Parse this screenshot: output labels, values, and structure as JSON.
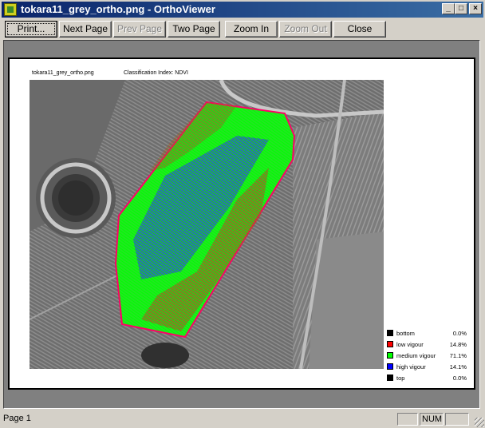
{
  "window": {
    "title": "tokara11_grey_ortho.png - OrthoViewer"
  },
  "title_buttons": {
    "minimize": "_",
    "maximize": "□",
    "close": "×"
  },
  "toolbar": {
    "print": "Print...",
    "next_page": "Next Page",
    "prev_page": "Prev Page",
    "two_page": "Two Page",
    "zoom_in": "Zoom In",
    "zoom_out": "Zoom Out",
    "close": "Close"
  },
  "page": {
    "filename": "tokara11_grey_ortho.png",
    "classification": "Classification Index: NDVI"
  },
  "legend": [
    {
      "label": "bottom",
      "percent": "0.0%",
      "color": "#000000"
    },
    {
      "label": "low vigour",
      "percent": "14.8%",
      "color": "#ff0000"
    },
    {
      "label": "medium vigour",
      "percent": "71.1%",
      "color": "#00ff00"
    },
    {
      "label": "high vigour",
      "percent": "14.1%",
      "color": "#0000ff"
    },
    {
      "label": "top",
      "percent": "0.0%",
      "color": "#000000"
    }
  ],
  "status": {
    "page": "Page 1",
    "num": "NUM"
  }
}
